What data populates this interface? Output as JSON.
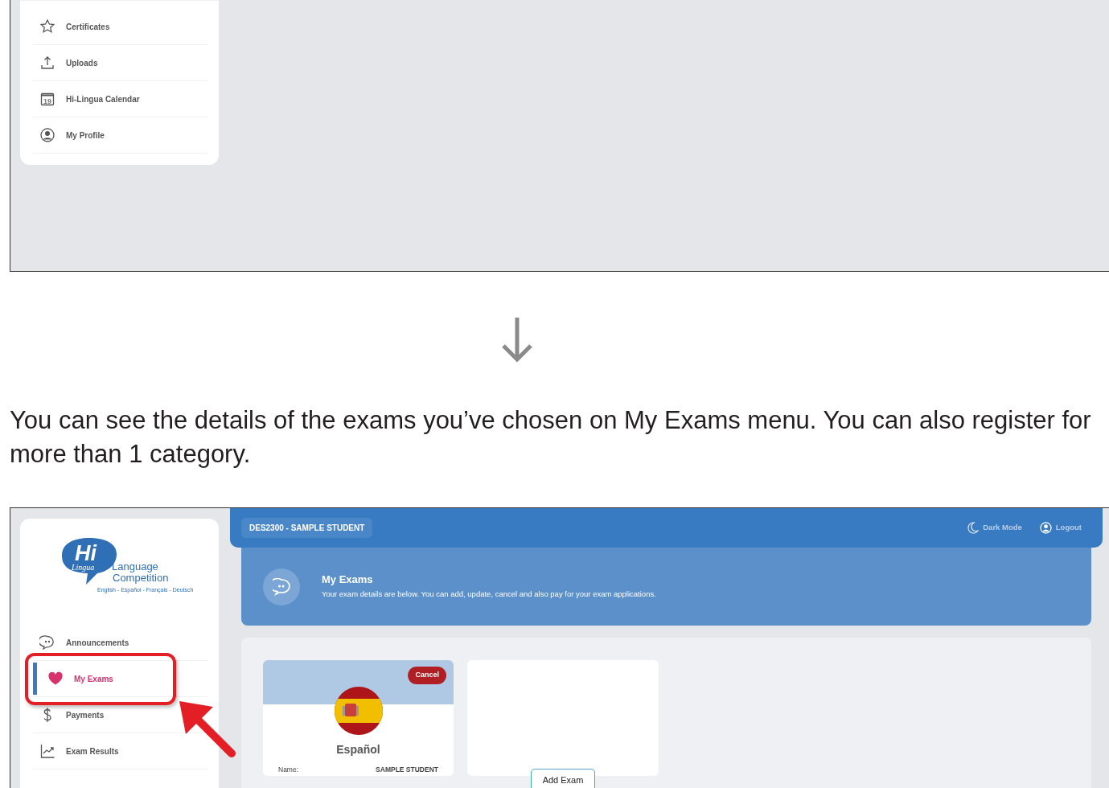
{
  "top_screenshot": {
    "sidebar_items": [
      {
        "label": "Certificates",
        "kind": "star",
        "selected": false
      },
      {
        "label": "Uploads",
        "kind": "upload",
        "selected": false
      },
      {
        "label": "Hi-Lingua Calendar",
        "kind": "calendar",
        "icon_text": "19",
        "selected": false
      },
      {
        "label": "My Profile",
        "kind": "profile",
        "selected": false
      }
    ]
  },
  "instruction": "You can see the details of the exams you’ve chosen on My Exams menu. You can also register for more than 1 category.",
  "bottom_screenshot": {
    "logo": {
      "mark": "Hi",
      "sub": "Lingua",
      "line1": "Language",
      "line2": "Competition",
      "languages": "English - Español - Français - Deutsch"
    },
    "sidebar_items": [
      {
        "label": "Announcements",
        "kind": "chat",
        "selected": false,
        "highlighted": false
      },
      {
        "label": "My Exams",
        "kind": "heart",
        "selected": true,
        "highlighted": true
      },
      {
        "label": "Payments",
        "kind": "dollar",
        "selected": false,
        "highlighted": false
      },
      {
        "label": "Exam Results",
        "kind": "chart",
        "selected": false,
        "highlighted": false
      }
    ],
    "topbar": {
      "user": "DES2300 - SAMPLE STUDENT",
      "dark_mode": "Dark Mode",
      "logout": "Logout"
    },
    "header": {
      "title": "My Exams",
      "description": "Your exam details are below. You can add, update, cancel and also pay for your exam applications."
    },
    "exam_cards": [
      {
        "language": "Español",
        "cancel": "Cancel",
        "fields": [
          {
            "label": "Name:",
            "value": "SAMPLE STUDENT"
          }
        ]
      }
    ],
    "add_exam": "Add Exam"
  }
}
